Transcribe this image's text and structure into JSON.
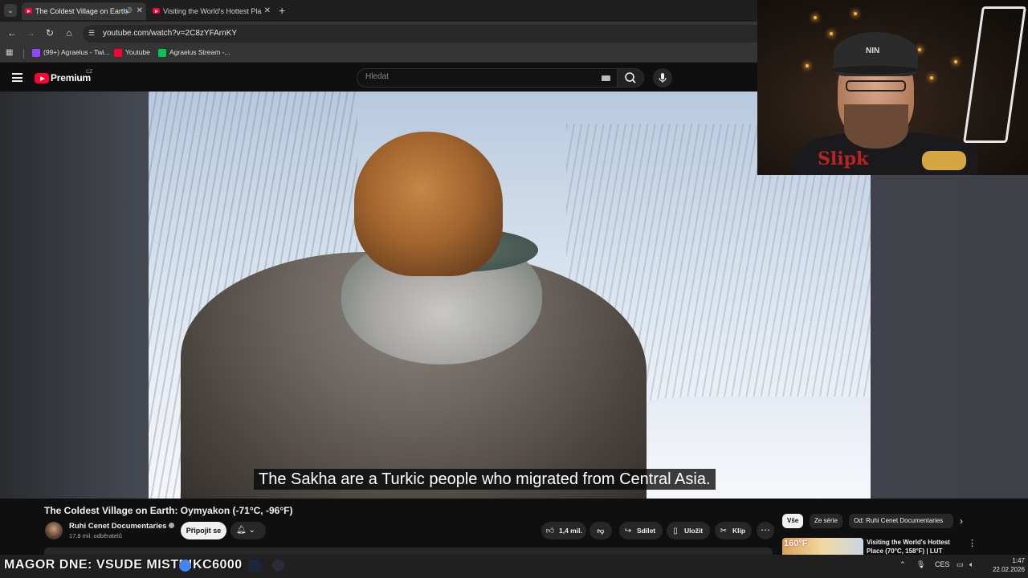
{
  "browser": {
    "tabs": [
      {
        "title": "The Coldest Village on Earth",
        "active": true
      },
      {
        "title": "Visiting the World's Hottest Pla",
        "active": false
      }
    ],
    "url": "youtube.com/watch?v=2C8zYFArnKY",
    "bookmarks": [
      {
        "label": "(99+) Agraelus - Twi...",
        "icon_color": "#9146ff"
      },
      {
        "label": "Youtube",
        "icon_color": "#ff0033"
      },
      {
        "label": "Agraelus Stream -...",
        "icon_color": "#00c853"
      }
    ]
  },
  "youtube": {
    "logo_text": "Premium",
    "logo_region": "CZ",
    "search_placeholder": "Hledat"
  },
  "video": {
    "subtitle": "The Sakha are a Turkic people who migrated from Central Asia.",
    "title": "The Coldest Village on Earth: Oymyakon (-71°C, -96°F)",
    "channel": "Ruhi Cenet Documentaries",
    "subscribers": "17,8 mil. odběratelů",
    "subscribe_label": "Připojit se",
    "likes": "1,4 mil.",
    "share_label": "Sdílet",
    "save_label": "Uložit",
    "clip_label": "Klip"
  },
  "sidebar": {
    "chips": [
      "Vše",
      "Ze série",
      "Od: Ruhi Cenet Documentaries"
    ],
    "recommendation": {
      "title": "Visiting the World's Hottest Place (70°C, 158°F) | LUT",
      "thumb_text": "160°F"
    }
  },
  "webcam": {
    "cap_text": "NIN",
    "shirt_text": "Slipk"
  },
  "taskbar": {
    "ticker": "MAGOR DNE: VSUDE   MISTNI",
    "ticker_tail": "KC6000",
    "language": "CES",
    "time": "1:47",
    "date": "22.02.2026"
  },
  "colors": {
    "youtube_red": "#ff0033",
    "background": "#0f0f0f",
    "chip_selected": "#f1f1f1"
  }
}
